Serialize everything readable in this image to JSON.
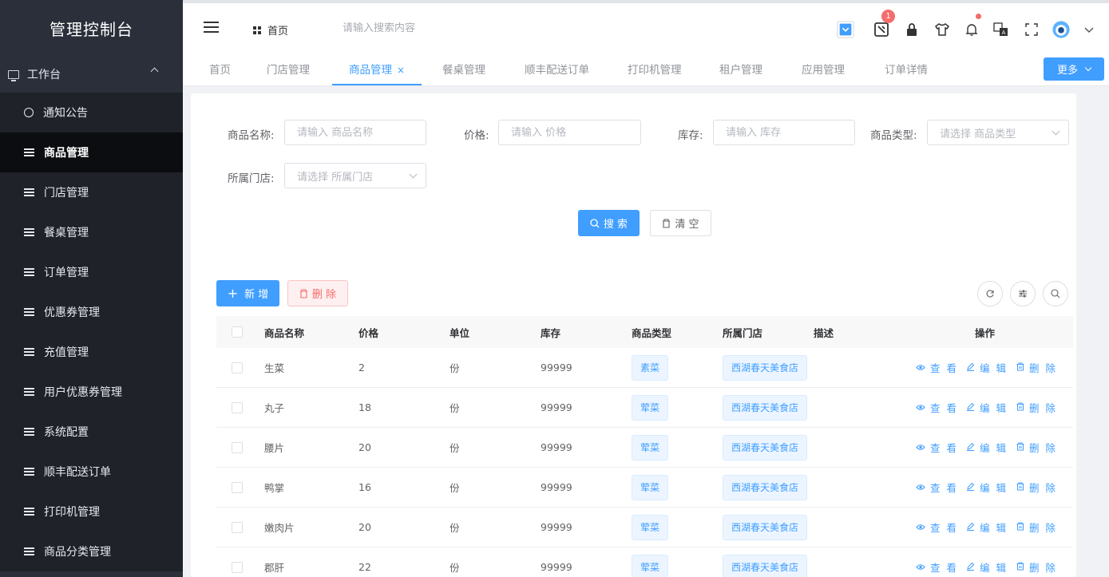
{
  "sidebar": {
    "title": "管理控制台",
    "group": "工作台",
    "items": [
      {
        "label": "通知公告",
        "icon": "circle-icon"
      },
      {
        "label": "商品管理",
        "icon": "list-icon",
        "active": true
      },
      {
        "label": "门店管理",
        "icon": "list-icon"
      },
      {
        "label": "餐桌管理",
        "icon": "list-icon"
      },
      {
        "label": "订单管理",
        "icon": "list-icon"
      },
      {
        "label": "优惠券管理",
        "icon": "list-icon"
      },
      {
        "label": "充值管理",
        "icon": "list-icon"
      },
      {
        "label": "用户优惠券管理",
        "icon": "list-icon"
      },
      {
        "label": "系统配置",
        "icon": "list-icon"
      },
      {
        "label": "顺丰配送订单",
        "icon": "list-icon"
      },
      {
        "label": "打印机管理",
        "icon": "list-icon"
      },
      {
        "label": "商品分类管理",
        "icon": "list-icon"
      }
    ]
  },
  "header": {
    "breadcrumb": "首页",
    "search_placeholder": "请输入搜索内容",
    "notification_badge": "1"
  },
  "tabs": {
    "items": [
      "首页",
      "门店管理",
      "商品管理",
      "餐桌管理",
      "顺丰配送订单",
      "打印机管理",
      "租户管理",
      "应用管理",
      "订单详情"
    ],
    "active": "商品管理",
    "close_glyph": "×",
    "more_label": "更多"
  },
  "filters": {
    "name_label": "商品名称:",
    "name_placeholder": "请输入 商品名称",
    "price_label": "价格:",
    "price_placeholder": "请输入 价格",
    "stock_label": "库存:",
    "stock_placeholder": "请输入 库存",
    "type_label": "商品类型:",
    "type_placeholder": "请选择 商品类型",
    "store_label": "所属门店:",
    "store_placeholder": "请选择 所属门店",
    "search_button": "搜 索",
    "clear_button": "清 空"
  },
  "toolbar": {
    "add_button": "新 增",
    "delete_button": "删 除"
  },
  "table": {
    "columns": [
      "商品名称",
      "价格",
      "单位",
      "库存",
      "商品类型",
      "所属门店",
      "描述",
      "操作"
    ],
    "rows": [
      {
        "name": "生菜",
        "price": "2",
        "unit": "份",
        "stock": "99999",
        "type": "素菜",
        "store": "西湖春天美食店",
        "desc": ""
      },
      {
        "name": "丸子",
        "price": "18",
        "unit": "份",
        "stock": "99999",
        "type": "荤菜",
        "store": "西湖春天美食店",
        "desc": ""
      },
      {
        "name": "腰片",
        "price": "20",
        "unit": "份",
        "stock": "99999",
        "type": "荤菜",
        "store": "西湖春天美食店",
        "desc": ""
      },
      {
        "name": "鸭掌",
        "price": "16",
        "unit": "份",
        "stock": "99999",
        "type": "荤菜",
        "store": "西湖春天美食店",
        "desc": ""
      },
      {
        "name": "嫩肉片",
        "price": "20",
        "unit": "份",
        "stock": "99999",
        "type": "荤菜",
        "store": "西湖春天美食店",
        "desc": ""
      },
      {
        "name": "郡肝",
        "price": "22",
        "unit": "份",
        "stock": "99999",
        "type": "荤菜",
        "store": "西湖春天美食店",
        "desc": ""
      }
    ],
    "actions": {
      "view": "查 看",
      "edit": "编 辑",
      "delete": "删 除"
    }
  },
  "colors": {
    "primary": "#409eff",
    "danger": "#f56c6c",
    "sidebar_bg": "#2b2f3a",
    "sidebar_active": "#0c0d10"
  }
}
